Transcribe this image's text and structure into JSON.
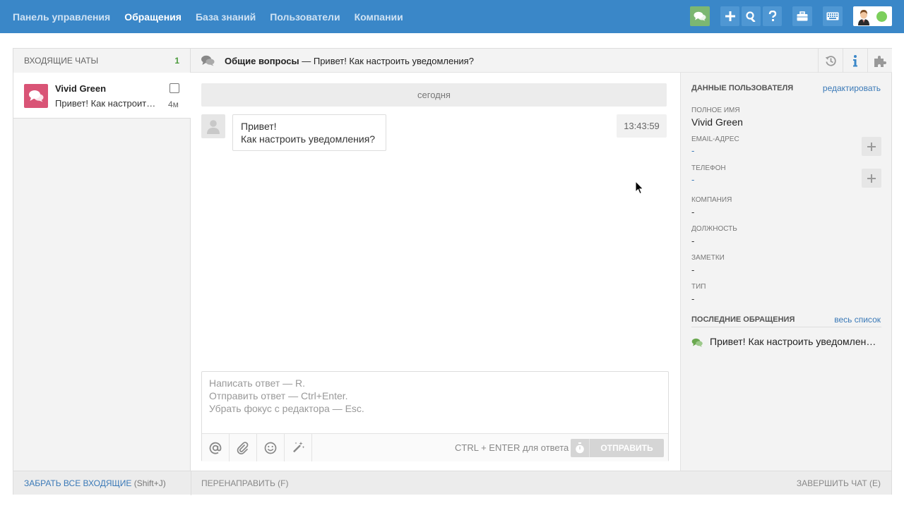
{
  "nav": {
    "items": [
      {
        "label": "Панель управления",
        "active": false
      },
      {
        "label": "Обращения",
        "active": true
      },
      {
        "label": "База знаний",
        "active": false
      },
      {
        "label": "Пользователи",
        "active": false
      },
      {
        "label": "Компании",
        "active": false
      }
    ],
    "icons": [
      "chat-icon",
      "plus-icon",
      "search-icon",
      "help-icon",
      "briefcase-icon",
      "keyboard-icon",
      "user-avatar-icon"
    ],
    "accent": "#3a87c8",
    "status_color": "#7ccf5c"
  },
  "inbox": {
    "title": "ВХОДЯЩИЕ ЧАТЫ",
    "count": "1",
    "chats": [
      {
        "name": "Vivid Green",
        "preview": "Привет! Как настроить уведомления?",
        "time": "4м"
      }
    ]
  },
  "conversation": {
    "group": "Общие вопросы",
    "separator": "—",
    "subject": "Привет! Как настроить уведомления?",
    "day_label": "сегодня",
    "message": {
      "line1": "Привет!",
      "line2": "Как настроить уведомления?",
      "time": "13:43:59"
    }
  },
  "editor": {
    "placeholder_1": "Написать ответ — R.",
    "placeholder_2": "Отправить ответ — Ctrl+Enter.",
    "placeholder_3": "Убрать фокус с редактора — Esc.",
    "hint": "CTRL + ENTER для ответа",
    "send_label": "ОТПРАВИТЬ"
  },
  "user_panel": {
    "title": "ДАННЫЕ ПОЛЬЗОВАТЕЛЯ",
    "edit_link": "редактировать",
    "fields": {
      "full_name": {
        "label": "ПОЛНОЕ ИМЯ",
        "value": "Vivid Green"
      },
      "email": {
        "label": "EMAIL-АДРЕС",
        "value": "-"
      },
      "phone": {
        "label": "ТЕЛЕФОН",
        "value": "-"
      },
      "company": {
        "label": "КОМПАНИЯ",
        "value": "-"
      },
      "position": {
        "label": "ДОЛЖНОСТЬ",
        "value": "-"
      },
      "notes": {
        "label": "ЗАМЕТКИ",
        "value": "-"
      },
      "type": {
        "label": "ТИП",
        "value": "-"
      }
    },
    "recent_title": "ПОСЛЕДНИЕ ОБРАЩЕНИЯ",
    "recent_link": "весь список",
    "recent_items": [
      "Привет! Как настроить уведомления?"
    ]
  },
  "footer": {
    "take_all": "ЗАБРАТЬ ВСЕ ВХОДЯЩИЕ",
    "take_all_shortcut": "(Shift+J)",
    "forward": "ПЕРЕНАПРАВИТЬ (F)",
    "finish": "ЗАВЕРШИТЬ ЧАТ (E)"
  }
}
